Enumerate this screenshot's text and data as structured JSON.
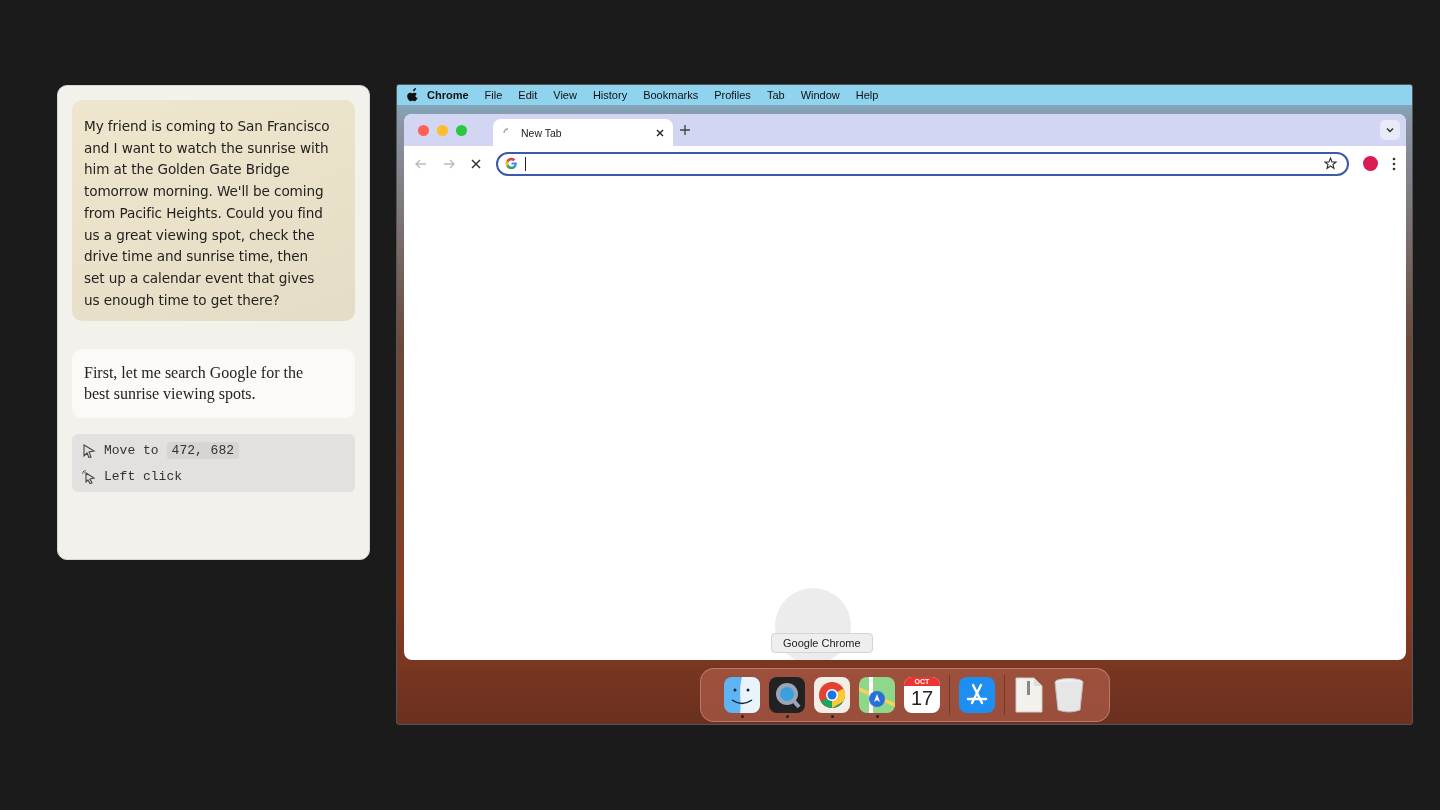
{
  "chat": {
    "user_message": "My friend is coming to San Francisco and I want to watch the sunrise with him at the Golden Gate Bridge tomorrow morning. We'll be coming from Pacific Heights. Could you find us a great viewing spot, check the drive time and sunrise time, then set up a calendar event that gives us enough time to get there?",
    "assistant_message": "First, let me search Google for the best sunrise viewing spots.",
    "actions": [
      {
        "kind": "move",
        "label": "Move to",
        "coords": "472, 682"
      },
      {
        "kind": "click",
        "label": "Left click"
      }
    ]
  },
  "menu_bar": {
    "app": "Chrome",
    "items": [
      "File",
      "Edit",
      "View",
      "History",
      "Bookmarks",
      "Profiles",
      "Tab",
      "Window",
      "Help"
    ]
  },
  "browser": {
    "tabs": [
      {
        "label": "New Tab",
        "selected": true,
        "loading": true
      }
    ],
    "nav": {
      "back_disabled": true,
      "forward_disabled": true
    },
    "address": {
      "focused": true
    }
  },
  "dock": {
    "tooltip": "Google Chrome",
    "items": [
      {
        "kind": "finder",
        "running": true
      },
      {
        "kind": "quicktime",
        "running": true
      },
      {
        "kind": "chrome",
        "running": true
      },
      {
        "kind": "maps",
        "running": true
      },
      {
        "kind": "calendar",
        "running": false,
        "month": "OCT",
        "day": "17"
      },
      {
        "kind": "separator"
      },
      {
        "kind": "appstore",
        "running": false
      },
      {
        "kind": "separator"
      },
      {
        "kind": "zip",
        "running": false
      },
      {
        "kind": "trash",
        "running": false
      }
    ]
  }
}
